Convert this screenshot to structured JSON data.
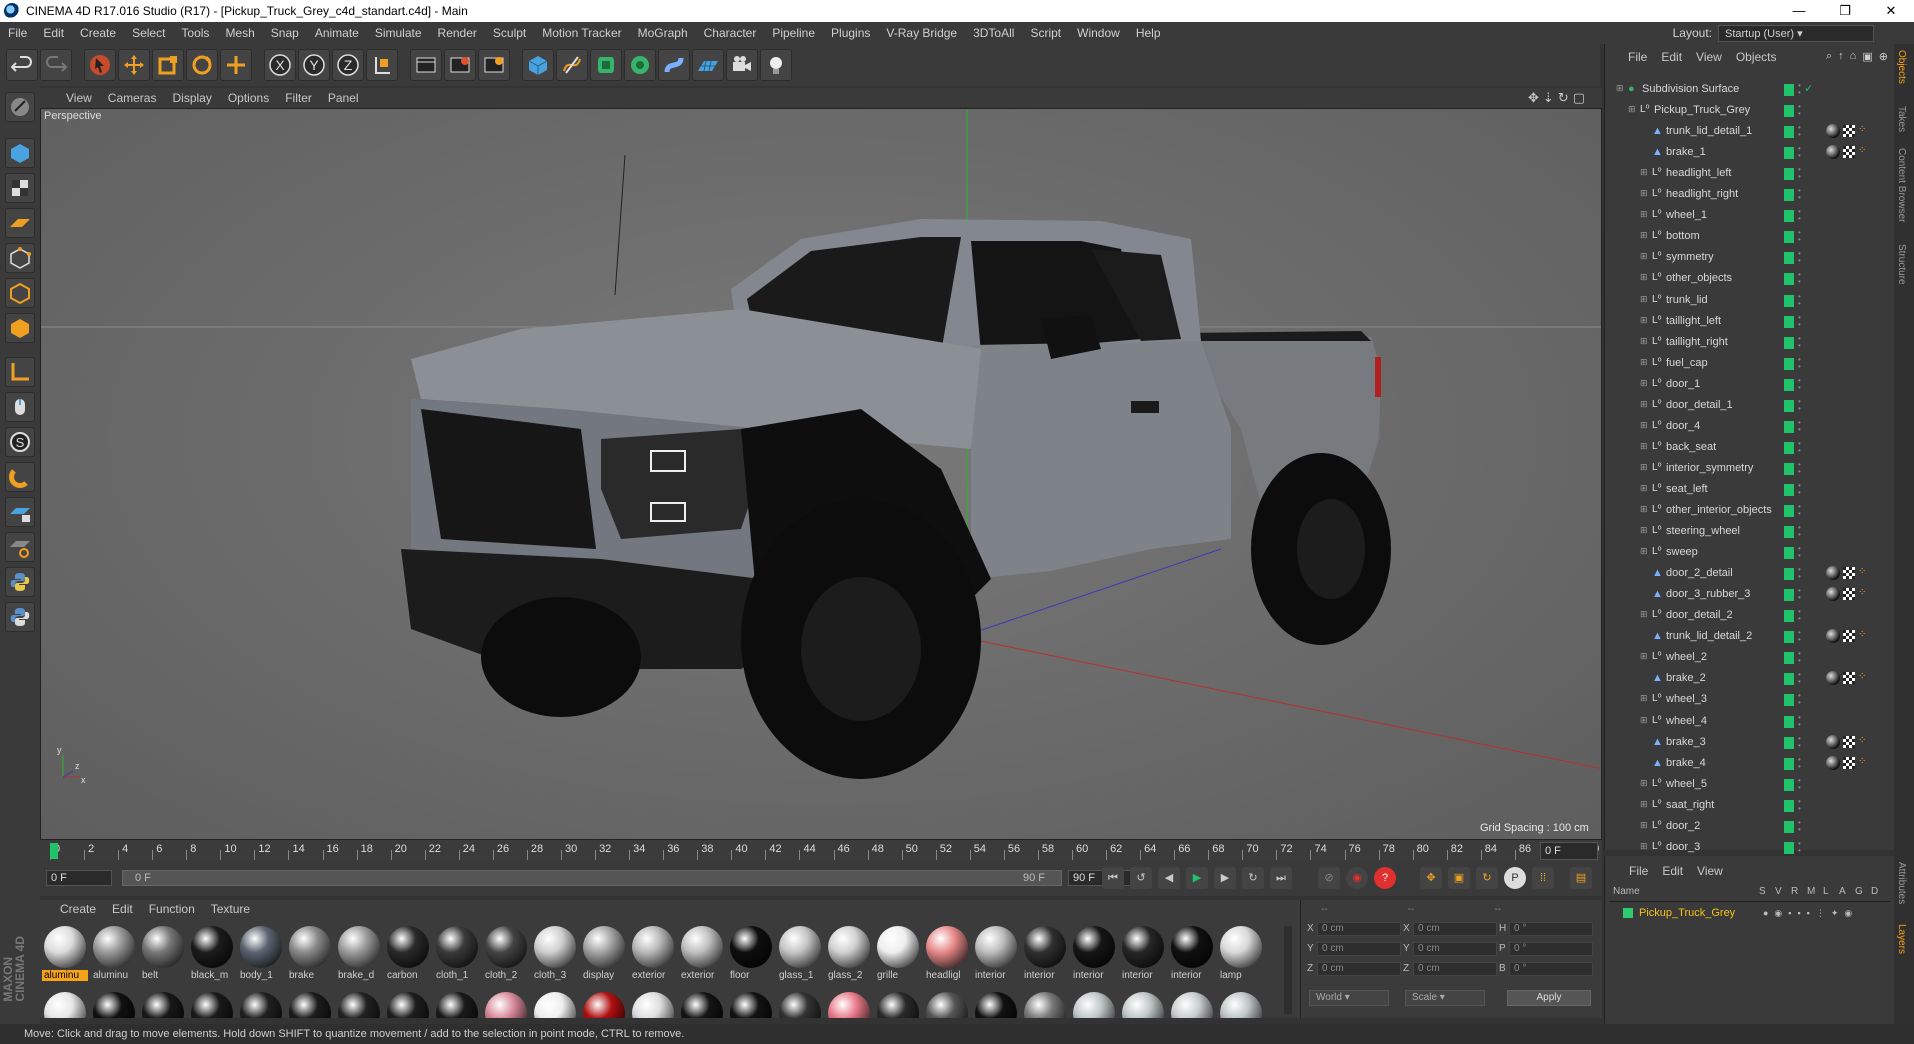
{
  "window": {
    "title": "CINEMA 4D R17.016 Studio (R17) - [Pickup_Truck_Grey_c4d_standart.c4d] - Main",
    "controls": [
      "—",
      "❐",
      "✕"
    ]
  },
  "menu": [
    "File",
    "Edit",
    "Create",
    "Select",
    "Tools",
    "Mesh",
    "Snap",
    "Animate",
    "Simulate",
    "Render",
    "Sculpt",
    "Motion Tracker",
    "MoGraph",
    "Character",
    "Pipeline",
    "Plugins",
    "V-Ray Bridge",
    "3DToAll",
    "Script",
    "Window",
    "Help"
  ],
  "layout": {
    "label": "Layout:",
    "value": "Startup (User)"
  },
  "viewport": {
    "menu": [
      "View",
      "Cameras",
      "Display",
      "Options",
      "Filter",
      "Panel"
    ],
    "camera": "Perspective",
    "grid_spacing": "Grid Spacing : 100 cm"
  },
  "timeline": {
    "ticks": [
      "0",
      "2",
      "4",
      "6",
      "8",
      "10",
      "12",
      "14",
      "16",
      "18",
      "20",
      "22",
      "24",
      "26",
      "28",
      "30",
      "32",
      "34",
      "36",
      "38",
      "40",
      "42",
      "44",
      "46",
      "48",
      "50",
      "52",
      "54",
      "56",
      "58",
      "60",
      "62",
      "64",
      "66",
      "68",
      "70",
      "72",
      "74",
      "76",
      "78",
      "80",
      "82",
      "84",
      "86",
      "88",
      "90"
    ],
    "current_frame": "0 F",
    "start": "0 F",
    "range_start": "0 F",
    "range_end": "90 F",
    "end": "90 F"
  },
  "materials": {
    "menu": [
      "Create",
      "Edit",
      "Function",
      "Texture"
    ],
    "row1": [
      {
        "name": "aluminu",
        "color": "#dcdcdc",
        "selected": true
      },
      {
        "name": "aluminu",
        "color": "#9a9a9a"
      },
      {
        "name": "belt",
        "color": "#777777"
      },
      {
        "name": "black_m",
        "color": "#1c1c1c"
      },
      {
        "name": "body_1",
        "color": "#5a6470"
      },
      {
        "name": "brake",
        "color": "#8a8a8a"
      },
      {
        "name": "brake_d",
        "color": "#9c9c9c"
      },
      {
        "name": "carbon",
        "color": "#2a2a2a"
      },
      {
        "name": "cloth_1",
        "color": "#3a3a3a"
      },
      {
        "name": "cloth_2",
        "color": "#444444"
      },
      {
        "name": "cloth_3",
        "color": "#cfcfcf"
      },
      {
        "name": "display",
        "color": "#a5a5a5"
      },
      {
        "name": "exterior",
        "color": "#b8b8b8"
      },
      {
        "name": "exterior",
        "color": "#bfbfbf"
      },
      {
        "name": "floor",
        "color": "#0e0e0e"
      },
      {
        "name": "glass_1",
        "color": "#c5c5c5"
      },
      {
        "name": "glass_2",
        "color": "#d0d0d0"
      },
      {
        "name": "grille",
        "color": "#eeeeee"
      },
      {
        "name": "headligl",
        "color": "#e88a8a"
      },
      {
        "name": "interior",
        "color": "#bdbdbd"
      },
      {
        "name": "interior",
        "color": "#303030"
      },
      {
        "name": "interior",
        "color": "#161616"
      },
      {
        "name": "interior",
        "color": "#262626"
      },
      {
        "name": "interior",
        "color": "#101010"
      },
      {
        "name": "lamp",
        "color": "#d8d8d8"
      }
    ],
    "row2": [
      "#e6e6e6",
      "#111111",
      "#181818",
      "#1a1a1a",
      "#202020",
      "#1c1c1c",
      "#222222",
      "#1e1e1e",
      "#1a1a1a",
      "#d88a9a",
      "#eeeeee",
      "#b01010",
      "#dddddd",
      "#141414",
      "#121212",
      "#333333",
      "#e87a8a",
      "#2a2a2a",
      "#555555",
      "#111111",
      "#777777",
      "#bfc7c7",
      "#bfc7c7",
      "#c7cccc",
      "#bfc5c5"
    ]
  },
  "coords": {
    "headers": [
      "--",
      "--",
      "--"
    ],
    "rows": [
      {
        "a": "X",
        "av": "0 cm",
        "b": "X",
        "bv": "0 cm",
        "c": "H",
        "cv": "0 °"
      },
      {
        "a": "Y",
        "av": "0 cm",
        "b": "Y",
        "bv": "0 cm",
        "c": "P",
        "cv": "0 °"
      },
      {
        "a": "Z",
        "av": "0 cm",
        "b": "Z",
        "bv": "0 cm",
        "c": "B",
        "cv": "0 °"
      }
    ],
    "mode": "World",
    "scale": "Scale",
    "apply": "Apply"
  },
  "objects": {
    "menu": [
      "File",
      "Edit",
      "View",
      "Objects"
    ],
    "items": [
      {
        "name": "Subdivision Surface",
        "depth": 0,
        "type": "subdiv"
      },
      {
        "name": "Pickup_Truck_Grey",
        "depth": 1,
        "type": "null"
      },
      {
        "name": "trunk_lid_detail_1",
        "depth": 2,
        "type": "poly",
        "tags": true
      },
      {
        "name": "brake_1",
        "depth": 2,
        "type": "poly",
        "tags": true
      },
      {
        "name": "headlight_left",
        "depth": 2,
        "type": "null"
      },
      {
        "name": "headlight_right",
        "depth": 2,
        "type": "null"
      },
      {
        "name": "wheel_1",
        "depth": 2,
        "type": "null"
      },
      {
        "name": "bottom",
        "depth": 2,
        "type": "null"
      },
      {
        "name": "symmetry",
        "depth": 2,
        "type": "null"
      },
      {
        "name": "other_objects",
        "depth": 2,
        "type": "null"
      },
      {
        "name": "trunk_lid",
        "depth": 2,
        "type": "null"
      },
      {
        "name": "taillight_left",
        "depth": 2,
        "type": "null"
      },
      {
        "name": "taillight_right",
        "depth": 2,
        "type": "null"
      },
      {
        "name": "fuel_cap",
        "depth": 2,
        "type": "null"
      },
      {
        "name": "door_1",
        "depth": 2,
        "type": "null"
      },
      {
        "name": "door_detail_1",
        "depth": 2,
        "type": "null"
      },
      {
        "name": "door_4",
        "depth": 2,
        "type": "null"
      },
      {
        "name": "back_seat",
        "depth": 2,
        "type": "null"
      },
      {
        "name": "interior_symmetry",
        "depth": 2,
        "type": "null"
      },
      {
        "name": "seat_left",
        "depth": 2,
        "type": "null"
      },
      {
        "name": "other_interior_objects",
        "depth": 2,
        "type": "null"
      },
      {
        "name": "steering_wheel",
        "depth": 2,
        "type": "null"
      },
      {
        "name": "sweep",
        "depth": 2,
        "type": "null"
      },
      {
        "name": "door_2_detail",
        "depth": 2,
        "type": "poly",
        "tags": true
      },
      {
        "name": "door_3_rubber_3",
        "depth": 2,
        "type": "poly",
        "tags": true
      },
      {
        "name": "door_detail_2",
        "depth": 2,
        "type": "null"
      },
      {
        "name": "trunk_lid_detail_2",
        "depth": 2,
        "type": "poly",
        "tags": true
      },
      {
        "name": "wheel_2",
        "depth": 2,
        "type": "null"
      },
      {
        "name": "brake_2",
        "depth": 2,
        "type": "poly",
        "tags": true
      },
      {
        "name": "wheel_3",
        "depth": 2,
        "type": "null"
      },
      {
        "name": "wheel_4",
        "depth": 2,
        "type": "null"
      },
      {
        "name": "brake_3",
        "depth": 2,
        "type": "poly",
        "tags": true
      },
      {
        "name": "brake_4",
        "depth": 2,
        "type": "poly",
        "tags": true
      },
      {
        "name": "wheel_5",
        "depth": 2,
        "type": "null"
      },
      {
        "name": "saat_right",
        "depth": 2,
        "type": "null"
      },
      {
        "name": "door_2",
        "depth": 2,
        "type": "null"
      },
      {
        "name": "door_3",
        "depth": 2,
        "type": "null"
      }
    ]
  },
  "layers": {
    "menu": [
      "File",
      "Edit",
      "View"
    ],
    "columns": [
      "Name",
      "S",
      "V",
      "R",
      "M",
      "L",
      "A",
      "G",
      "D"
    ],
    "item": "Pickup_Truck_Grey",
    "item_color": "#2ecc71"
  },
  "side_tabs": [
    "Objects",
    "Takes",
    "Content Browser",
    "Structure"
  ],
  "side_tabs_bottom": [
    "Attributes",
    "Layers"
  ],
  "status": "Move: Click and drag to move elements. Hold down SHIFT to quantize movement / add to the selection in point mode, CTRL to remove.",
  "colors": {
    "accent": "#f6a21a",
    "green_tag": "#21c36a",
    "panel": "#3a3a3a"
  }
}
